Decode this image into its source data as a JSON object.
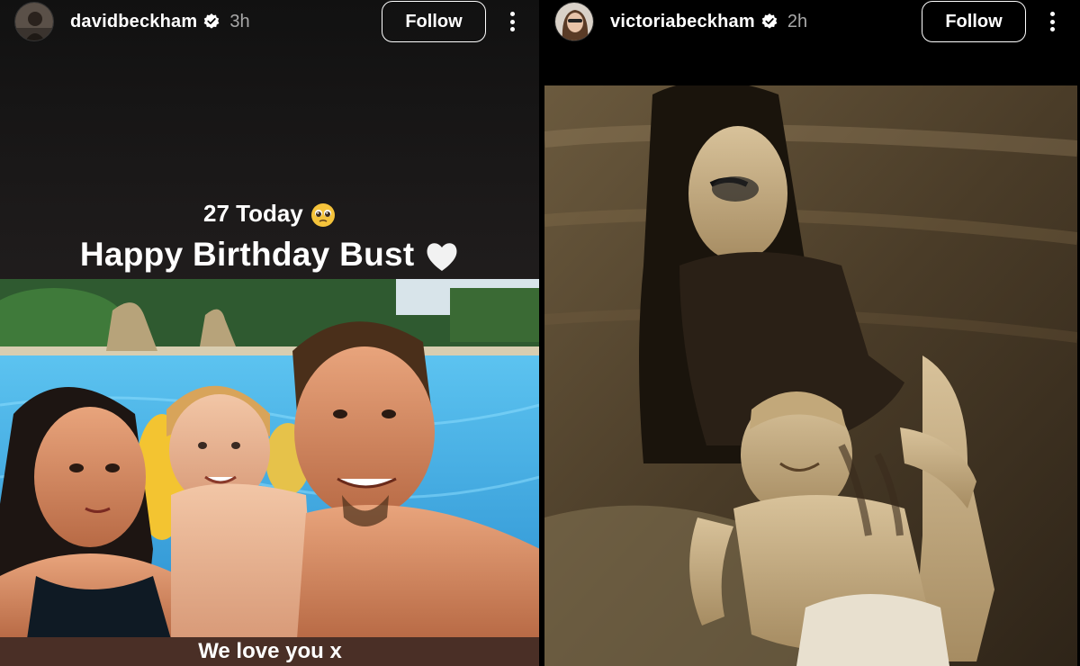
{
  "stories": [
    {
      "username": "davidbeckham",
      "time": "3h",
      "follow_label": "Follow",
      "caption_top": "27 Today",
      "caption_top_emoji": "pleading-face-emoji",
      "caption_main": "Happy Birthday Bust",
      "caption_main_emoji": "white-heart-emoji",
      "caption_bottom": "We love you x"
    },
    {
      "username": "victoriabeckham",
      "time": "2h",
      "follow_label": "Follow"
    }
  ],
  "icons": {
    "verified": "verified-badge-icon",
    "more": "more-options-icon"
  },
  "colors": {
    "verified_badge": "#ffffff",
    "caption_bar": "#4a2f26"
  }
}
